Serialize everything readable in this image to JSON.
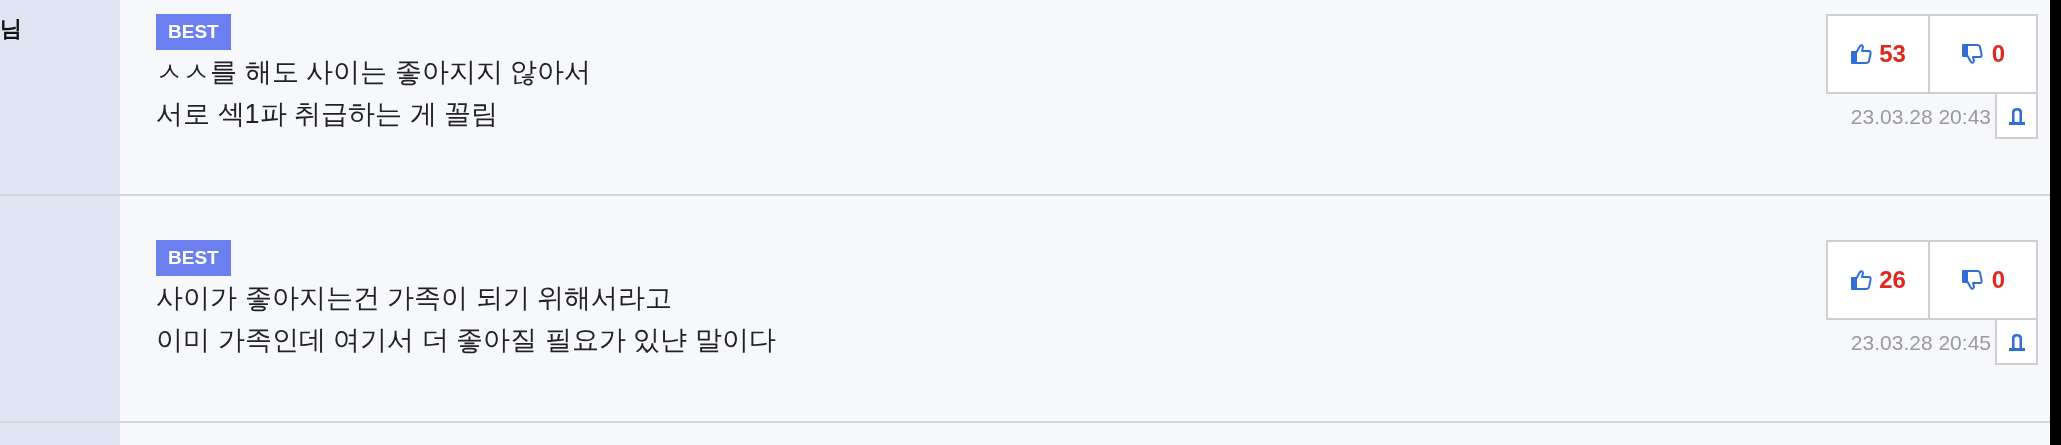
{
  "author_fragment": "님",
  "comments": [
    {
      "badge": "BEST",
      "lines": [
        "ㅅㅅ를 해도 사이는 좋아지지 않아서",
        "서로 섹1파 취급하는 게 꼴림"
      ],
      "likes": "53",
      "dislikes": "0",
      "date": "23.03.28 20:43"
    },
    {
      "badge": "BEST",
      "lines": [
        "사이가 좋아지는건 가족이 되기 위해서라고",
        "이미 가족인데 여기서 더 좋아질 필요가 있냔 말이다"
      ],
      "likes": "26",
      "dislikes": "0",
      "date": "23.03.28 20:45"
    }
  ]
}
